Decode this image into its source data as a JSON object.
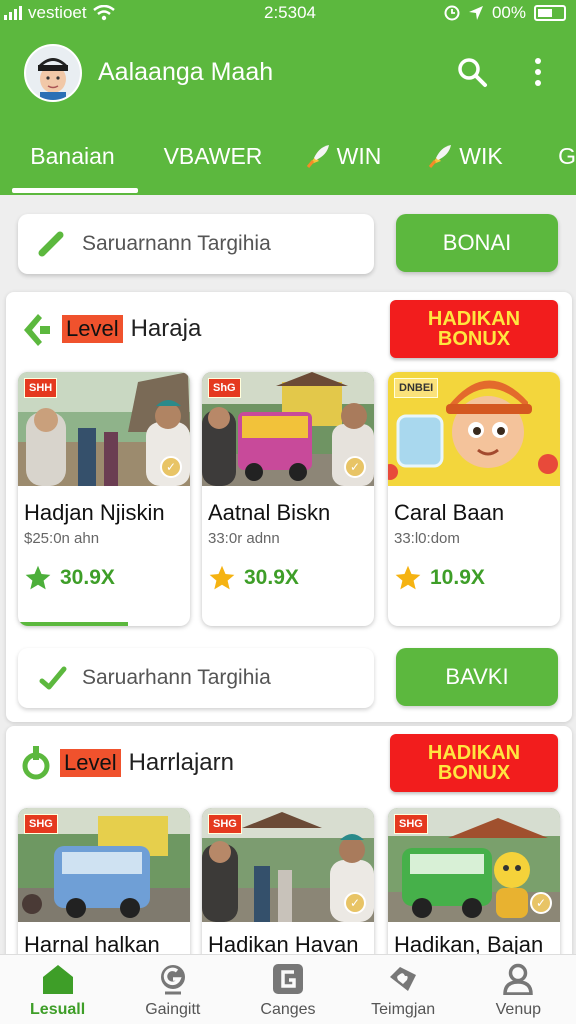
{
  "status_bar": {
    "carrier": "vestioet",
    "time": "2:5304",
    "battery": "00%"
  },
  "header": {
    "user_name": "Aalaanga Maah"
  },
  "tabs": [
    {
      "label": "Banaian",
      "active": true
    },
    {
      "label": "VBAWER",
      "active": false
    },
    {
      "label": "WIN",
      "active": false
    },
    {
      "label": "WIK",
      "active": false
    },
    {
      "label": "G",
      "active": false
    }
  ],
  "top_search": {
    "text": "Saruarnann Targihia",
    "button": "BONAI"
  },
  "section1": {
    "level": "Level",
    "title": "Haraja",
    "bonus": "HADIKAN BONUX",
    "items": [
      {
        "tag": "SHH",
        "title": "Hadjan Njiskin",
        "subtitle": "$25:0n ahn",
        "rating": "30.9X"
      },
      {
        "tag": "ShG",
        "title": "Aatnal Biskn",
        "subtitle": "33:0r adnn",
        "rating": "30.9X"
      },
      {
        "tag": "DNBEI",
        "title": "Caral Baan",
        "subtitle": "33:l0:dom",
        "rating": "10.9X"
      }
    ],
    "search_text": "Saruarhann Targihia",
    "search_button": "BAVKI"
  },
  "section2": {
    "level": "Level",
    "title": "Harrlajarn",
    "bonus": "HADIKAN BONUX",
    "items": [
      {
        "tag": "SHG",
        "title": "Harnal halkan"
      },
      {
        "tag": "SHG",
        "title": "Hadikan Havan"
      },
      {
        "tag": "SHG",
        "title": "Hadikan, Bajan"
      }
    ]
  },
  "bottom_nav": [
    {
      "label": "Lesuall",
      "active": true
    },
    {
      "label": "Gaingitt",
      "active": false
    },
    {
      "label": "Canges",
      "active": false
    },
    {
      "label": "Teimgjan",
      "active": false
    },
    {
      "label": "Venup",
      "active": false
    }
  ],
  "colors": {
    "brand_green": "#5cb83e",
    "bonus_red": "#f21d1d",
    "bonus_text": "#ffe640",
    "star_green": "#4caf3a",
    "star_gold": "#f5b312"
  }
}
